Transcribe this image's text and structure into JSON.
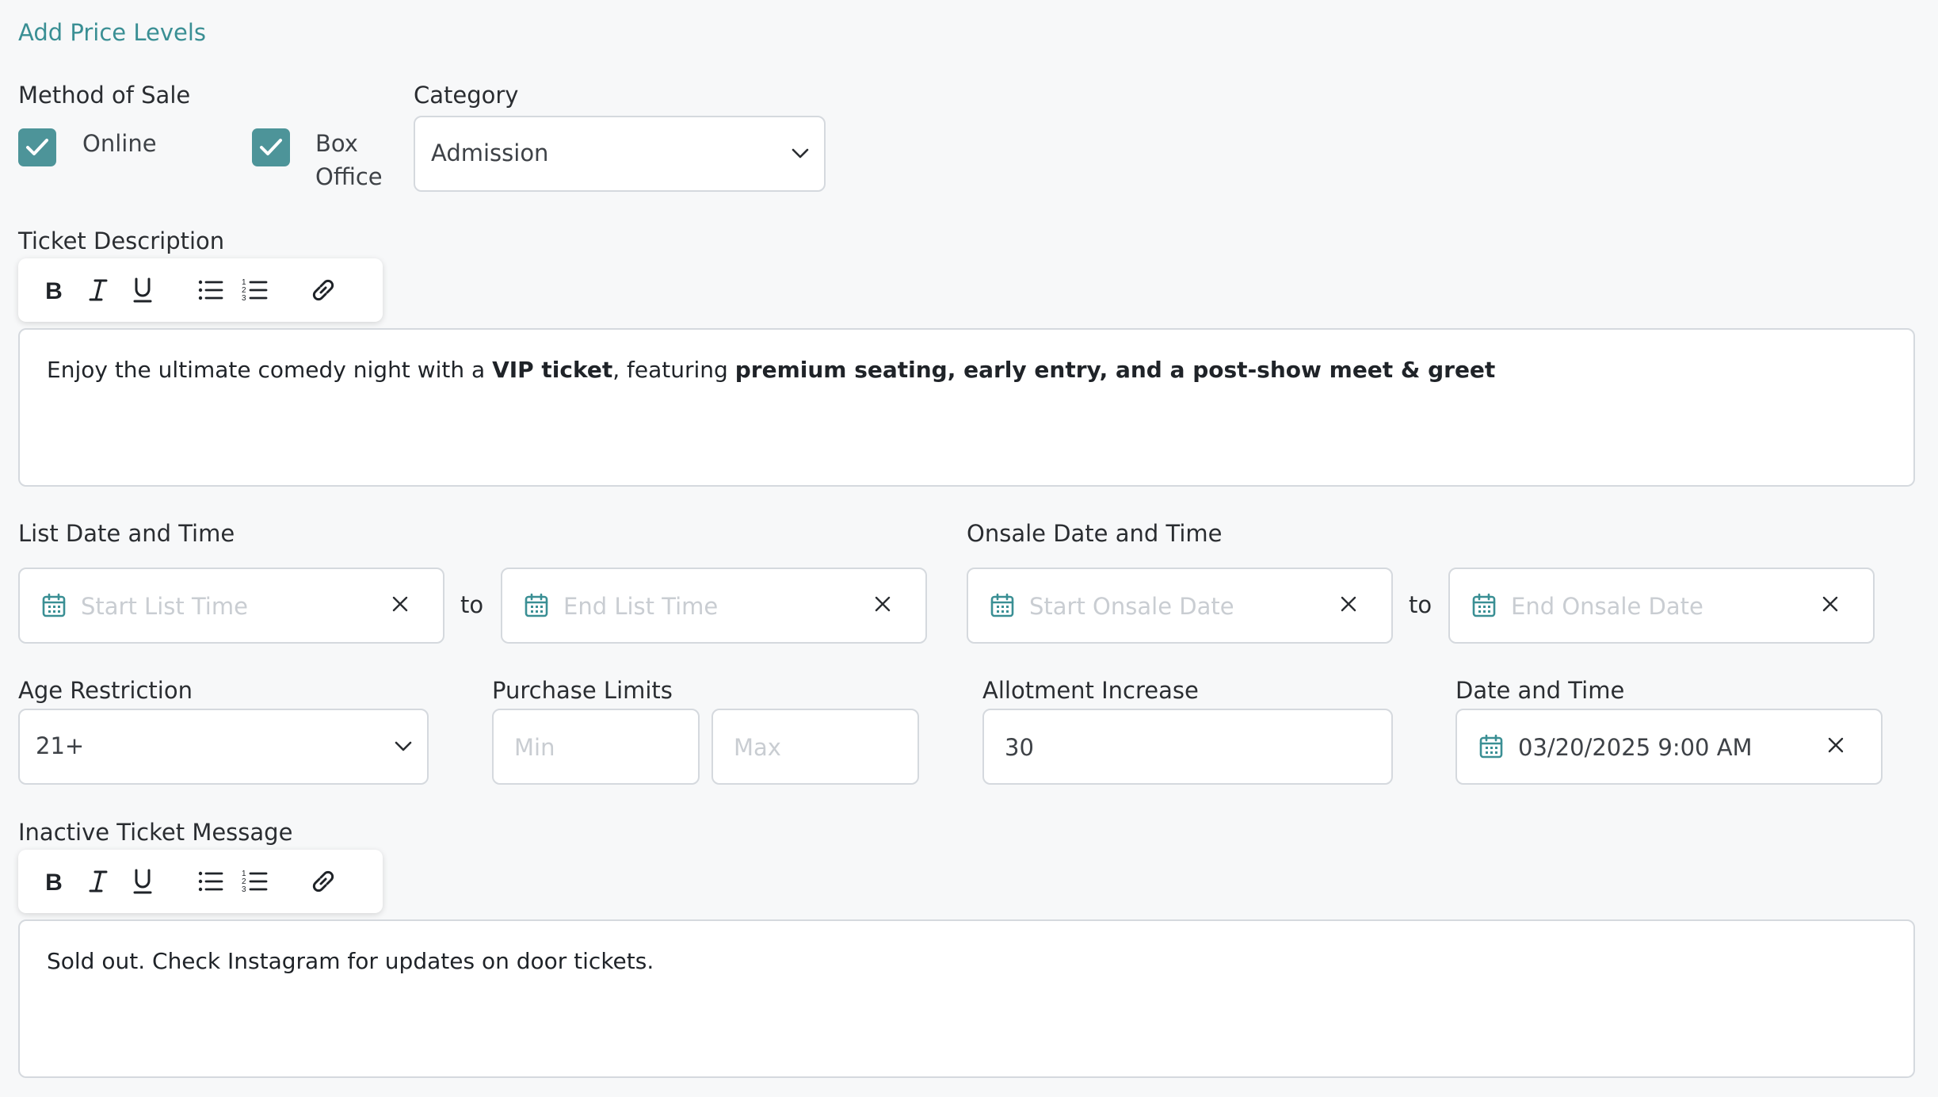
{
  "header": {
    "add_price_levels": "Add Price Levels"
  },
  "method_of_sale": {
    "label": "Method of Sale",
    "options": [
      {
        "label": "Online",
        "checked": true
      },
      {
        "label_line1": "Box",
        "label_line2": "Office",
        "checked": true
      }
    ]
  },
  "category": {
    "label": "Category",
    "value": "Admission"
  },
  "ticket_description": {
    "label": "Ticket Description",
    "text_1": "Enjoy the ultimate comedy night with a ",
    "bold_1": "VIP ticket",
    "text_2": ", featuring ",
    "bold_2": "premium seating, early entry, and a post-show meet & greet"
  },
  "list_date": {
    "label": "List Date and Time",
    "start_placeholder": "Start List Time",
    "end_placeholder": "End List Time",
    "to": "to"
  },
  "onsale_date": {
    "label": "Onsale Date and Time",
    "start_placeholder": "Start Onsale Date",
    "end_placeholder": "End Onsale Date",
    "to": "to"
  },
  "age_restriction": {
    "label": "Age Restriction",
    "value": "21+"
  },
  "purchase_limits": {
    "label": "Purchase Limits",
    "min_placeholder": "Min",
    "max_placeholder": "Max"
  },
  "allotment_increase": {
    "label": "Allotment Increase",
    "value": "30"
  },
  "date_and_time": {
    "label": "Date and Time",
    "value": "03/20/2025 9:00 AM"
  },
  "inactive_message": {
    "label": "Inactive Ticket Message",
    "text": "Sold out. Check Instagram for updates on door tickets."
  },
  "toolbar": {
    "bold": "B",
    "italic": "I",
    "underline": "U",
    "icons": [
      "bold-icon",
      "italic-icon",
      "underline-icon",
      "bullet-list-icon",
      "numbered-list-icon",
      "link-icon"
    ]
  },
  "colors": {
    "accent": "#3a8f94",
    "checkbox": "#4d9499",
    "border": "#d5d9de",
    "placeholder": "#c9cdd2"
  }
}
